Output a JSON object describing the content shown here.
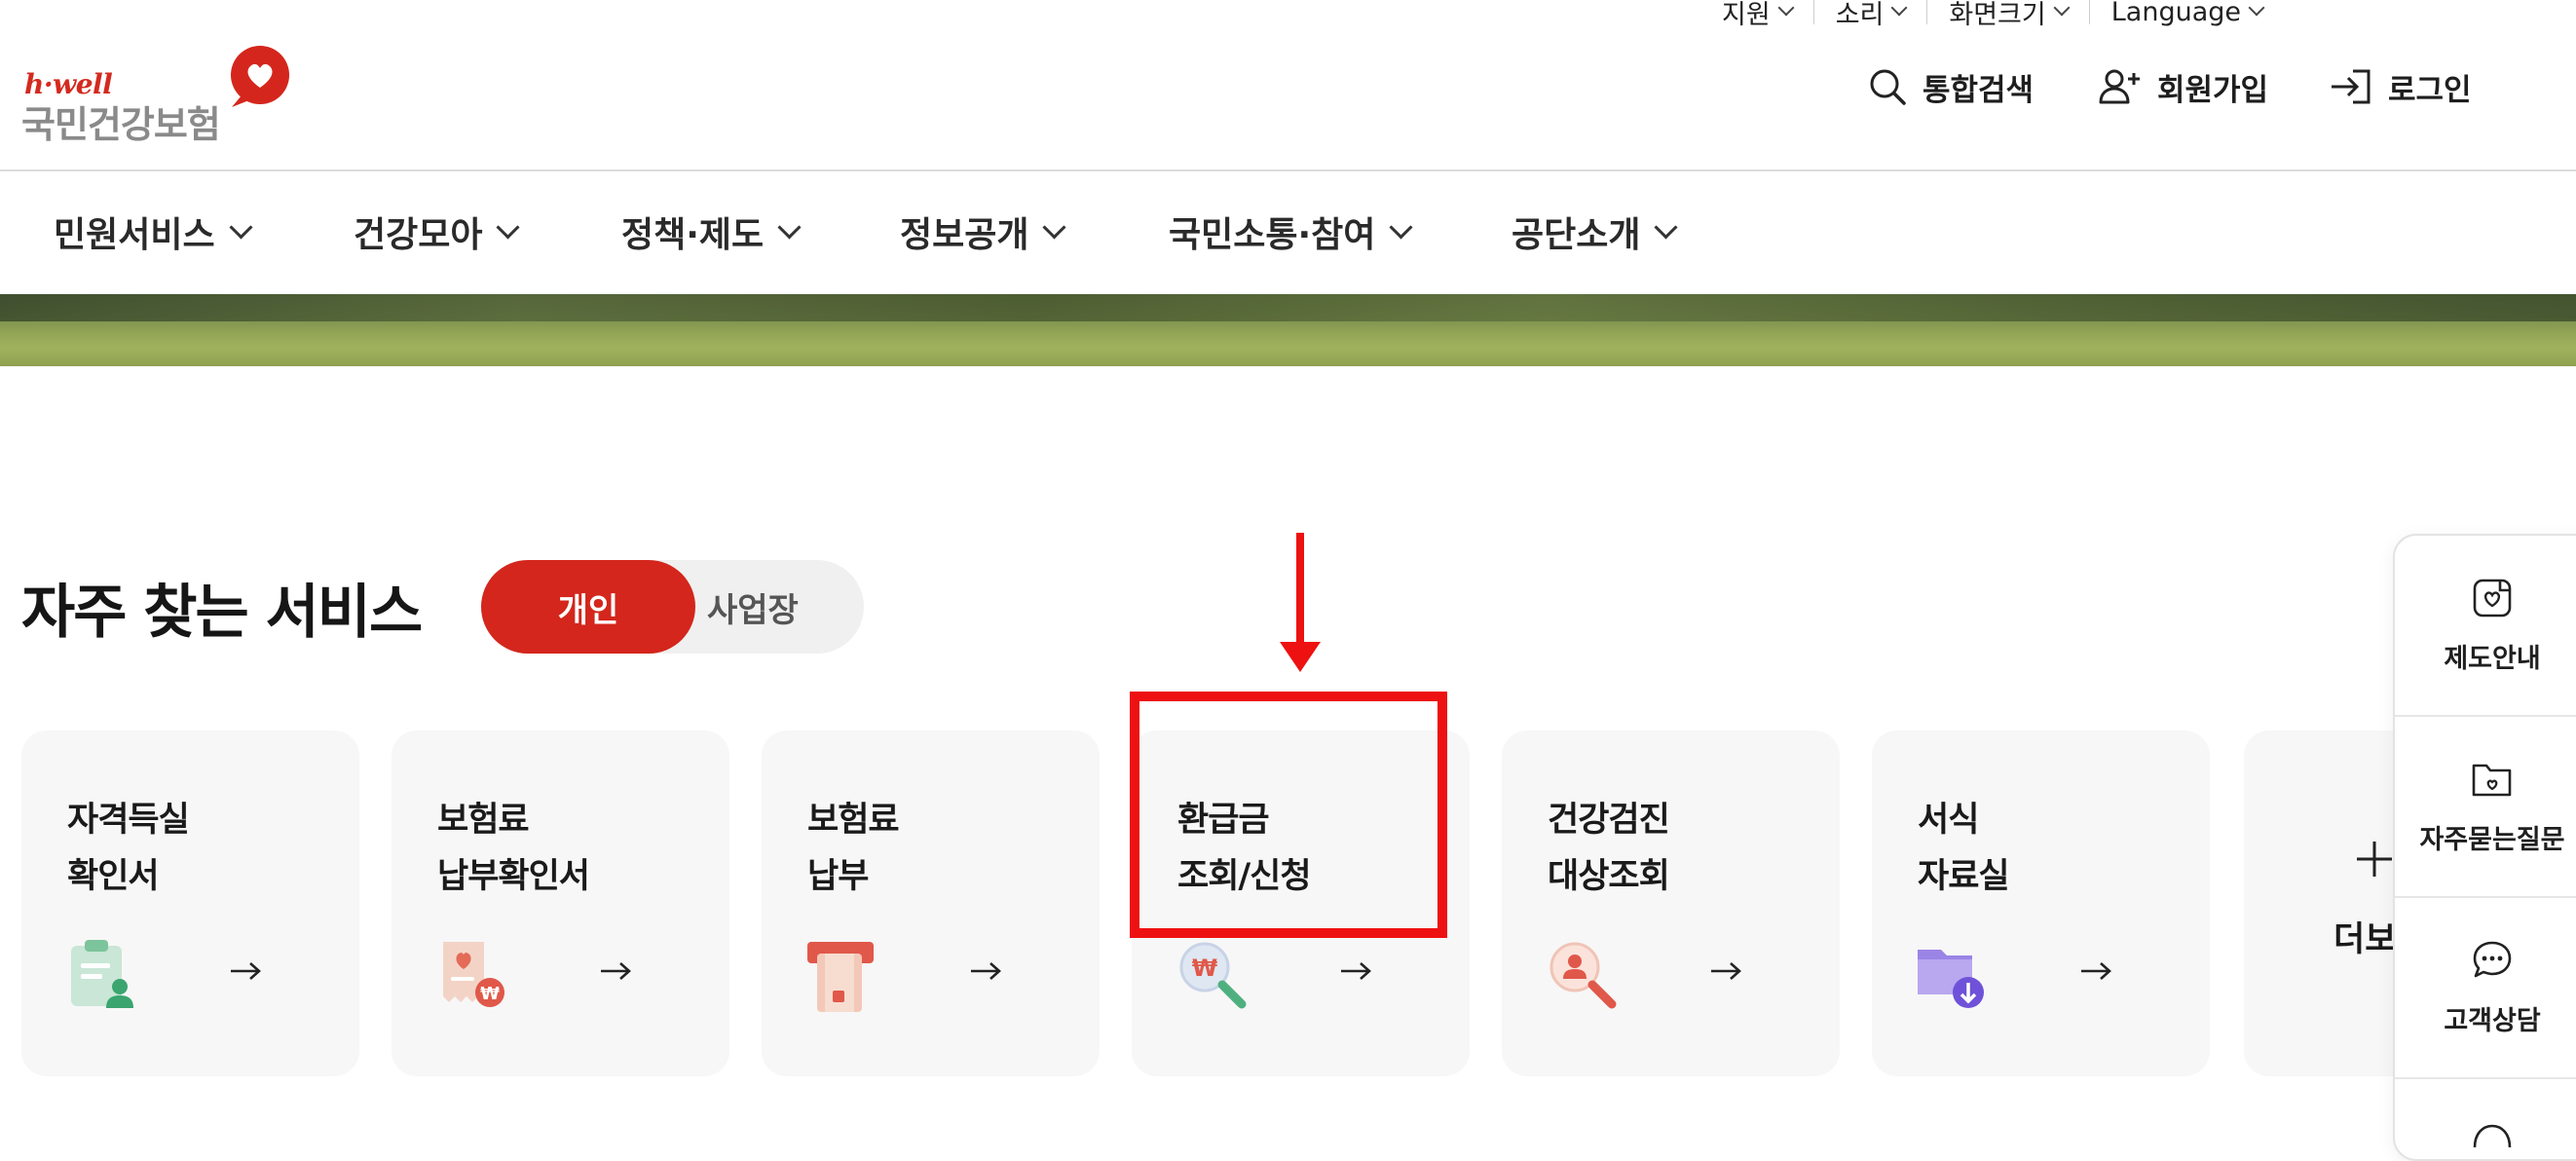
{
  "utility": {
    "items": [
      "지원",
      "소리",
      "화면크기",
      "Language"
    ]
  },
  "logo": {
    "brand": "h·well",
    "name": "국민건강보험"
  },
  "actions": {
    "search": "통합검색",
    "join": "회원가입",
    "login": "로그인"
  },
  "gnb": [
    "민원서비스",
    "건강모아",
    "정책·제도",
    "정보공개",
    "국민소통·참여",
    "공단소개"
  ],
  "section": {
    "title": "자주 찾는 서비스",
    "toggle_personal": "개인",
    "toggle_business": "사업장"
  },
  "cards": [
    {
      "line1": "자격득실",
      "line2": "확인서",
      "icon": "certificate-person-icon"
    },
    {
      "line1": "보험료",
      "line2": "납부확인서",
      "icon": "receipt-won-icon"
    },
    {
      "line1": "보험료",
      "line2": "납부",
      "icon": "card-payment-icon"
    },
    {
      "line1": "환급금",
      "line2": "조회/신청",
      "icon": "won-magnifier-icon"
    },
    {
      "line1": "건강검진",
      "line2": "대상조회",
      "icon": "person-magnifier-icon"
    },
    {
      "line1": "서식",
      "line2": "자료실",
      "icon": "folder-download-icon"
    }
  ],
  "more": {
    "label": "더보"
  },
  "quick_menu": [
    {
      "label": "제도안내",
      "icon": "guide-icon"
    },
    {
      "label": "자주묻는질문",
      "icon": "faq-folder-icon"
    },
    {
      "label": "고객상담",
      "icon": "chat-icon"
    }
  ],
  "colors": {
    "brand_red": "#d4261c",
    "annotation_red": "#ee1111",
    "card_bg": "#f7f7f7"
  }
}
